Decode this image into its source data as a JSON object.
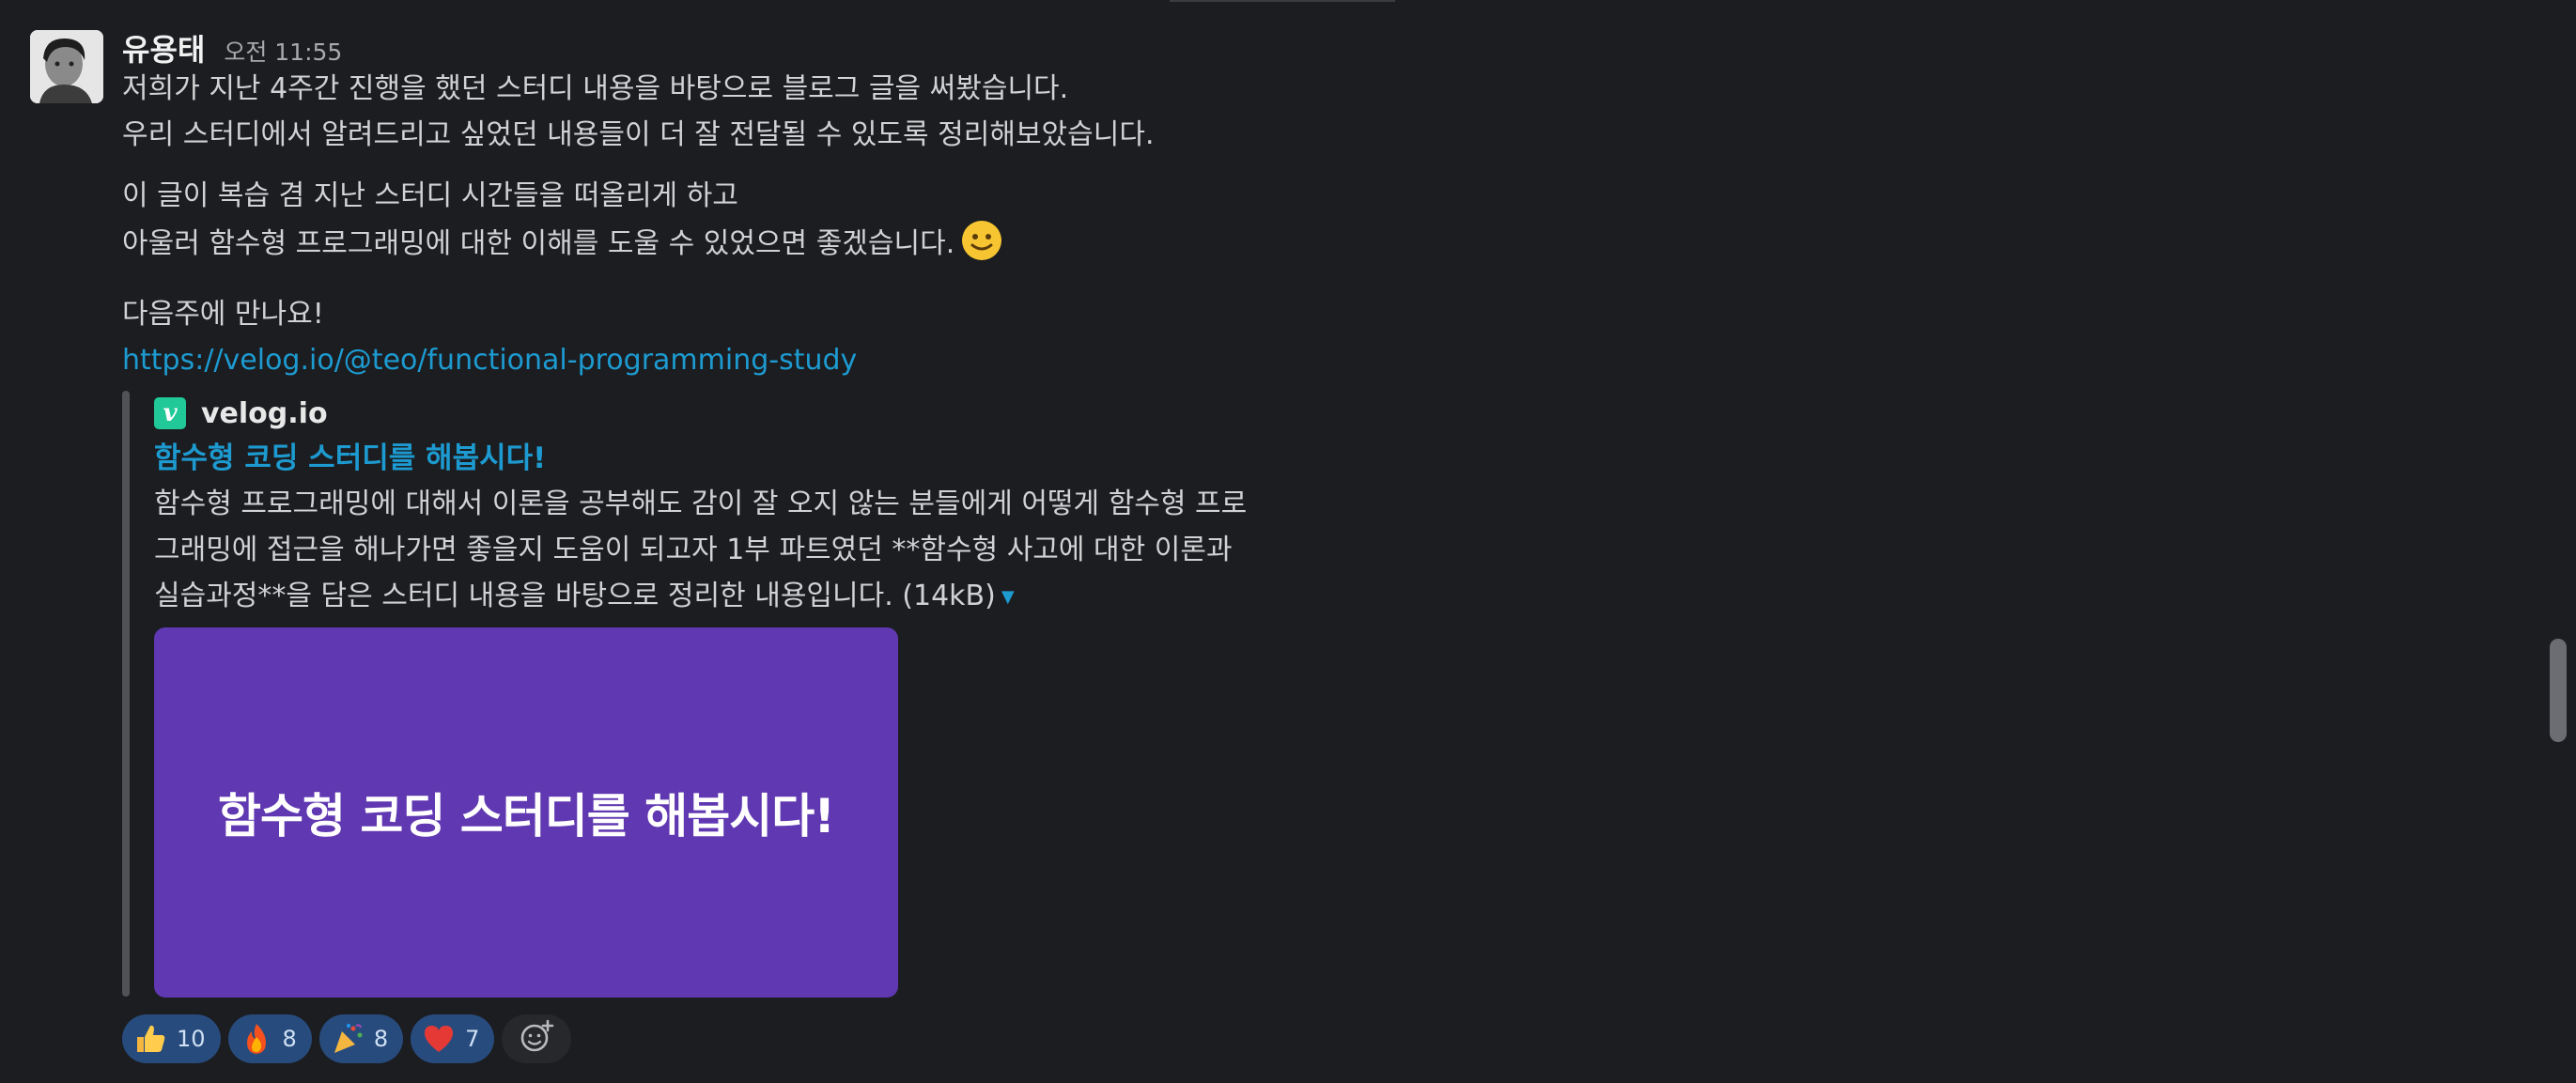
{
  "message": {
    "author": "유용태",
    "timestamp": "오전 11:55",
    "lines": [
      "저희가 지난 4주간 진행을 했던 스터디 내용을 바탕으로 블로그 글을 써봤습니다.",
      "우리 스터디에서 알려드리고 싶었던 내용들이 더 잘 전달될 수 있도록 정리해보았습니다.",
      "이 글이 복습 겸 지난 스터디 시간들을 떠올리게 하고",
      "아울러 함수형 프로그래밍에 대한 이해를 도울 수 있었으면 좋겠습니다.",
      "다음주에 만나요!"
    ],
    "emoji": "slightly-smiling-face-icon",
    "link": "https://velog.io/@teo/functional-programming-study"
  },
  "unfurl": {
    "site_name": "velog.io",
    "site_icon_letter": "v",
    "title": "함수형 코딩 스터디를 해봅시다!",
    "description_lines": [
      "함수형 프로그래밍에 대해서 이론을 공부해도 감이 잘 오지 않는 분들에게 어떻게 함수형 프로",
      "그래밍에 접근을 해나가면 좋을지 도움이 되고자 1부 파트였던 **함수형 사고에 대한 이론과",
      "실습과정**을 담은 스터디 내용을 바탕으로 정리한 내용입니다. (14kB)"
    ],
    "preview_text": "함수형 코딩 스터디를 해봅시다!",
    "preview_color": "#6038b1"
  },
  "reactions": [
    {
      "icon": "thumbs-up-icon",
      "count": "10"
    },
    {
      "icon": "fire-icon",
      "count": "8"
    },
    {
      "icon": "party-popper-icon",
      "count": "8"
    },
    {
      "icon": "red-heart-icon",
      "count": "7"
    }
  ],
  "colors": {
    "accent": "#1d9bd1",
    "background": "#1b1d21",
    "reaction_bg": "#284b7d"
  }
}
